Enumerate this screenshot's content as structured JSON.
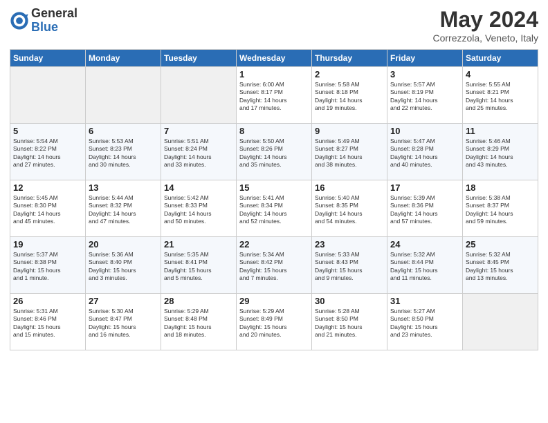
{
  "header": {
    "logo_general": "General",
    "logo_blue": "Blue",
    "month_title": "May 2024",
    "location": "Correzzola, Veneto, Italy"
  },
  "weekdays": [
    "Sunday",
    "Monday",
    "Tuesday",
    "Wednesday",
    "Thursday",
    "Friday",
    "Saturday"
  ],
  "weeks": [
    [
      {
        "day": "",
        "info": ""
      },
      {
        "day": "",
        "info": ""
      },
      {
        "day": "",
        "info": ""
      },
      {
        "day": "1",
        "info": "Sunrise: 6:00 AM\nSunset: 8:17 PM\nDaylight: 14 hours\nand 17 minutes."
      },
      {
        "day": "2",
        "info": "Sunrise: 5:58 AM\nSunset: 8:18 PM\nDaylight: 14 hours\nand 19 minutes."
      },
      {
        "day": "3",
        "info": "Sunrise: 5:57 AM\nSunset: 8:19 PM\nDaylight: 14 hours\nand 22 minutes."
      },
      {
        "day": "4",
        "info": "Sunrise: 5:55 AM\nSunset: 8:21 PM\nDaylight: 14 hours\nand 25 minutes."
      }
    ],
    [
      {
        "day": "5",
        "info": "Sunrise: 5:54 AM\nSunset: 8:22 PM\nDaylight: 14 hours\nand 27 minutes."
      },
      {
        "day": "6",
        "info": "Sunrise: 5:53 AM\nSunset: 8:23 PM\nDaylight: 14 hours\nand 30 minutes."
      },
      {
        "day": "7",
        "info": "Sunrise: 5:51 AM\nSunset: 8:24 PM\nDaylight: 14 hours\nand 33 minutes."
      },
      {
        "day": "8",
        "info": "Sunrise: 5:50 AM\nSunset: 8:26 PM\nDaylight: 14 hours\nand 35 minutes."
      },
      {
        "day": "9",
        "info": "Sunrise: 5:49 AM\nSunset: 8:27 PM\nDaylight: 14 hours\nand 38 minutes."
      },
      {
        "day": "10",
        "info": "Sunrise: 5:47 AM\nSunset: 8:28 PM\nDaylight: 14 hours\nand 40 minutes."
      },
      {
        "day": "11",
        "info": "Sunrise: 5:46 AM\nSunset: 8:29 PM\nDaylight: 14 hours\nand 43 minutes."
      }
    ],
    [
      {
        "day": "12",
        "info": "Sunrise: 5:45 AM\nSunset: 8:30 PM\nDaylight: 14 hours\nand 45 minutes."
      },
      {
        "day": "13",
        "info": "Sunrise: 5:44 AM\nSunset: 8:32 PM\nDaylight: 14 hours\nand 47 minutes."
      },
      {
        "day": "14",
        "info": "Sunrise: 5:42 AM\nSunset: 8:33 PM\nDaylight: 14 hours\nand 50 minutes."
      },
      {
        "day": "15",
        "info": "Sunrise: 5:41 AM\nSunset: 8:34 PM\nDaylight: 14 hours\nand 52 minutes."
      },
      {
        "day": "16",
        "info": "Sunrise: 5:40 AM\nSunset: 8:35 PM\nDaylight: 14 hours\nand 54 minutes."
      },
      {
        "day": "17",
        "info": "Sunrise: 5:39 AM\nSunset: 8:36 PM\nDaylight: 14 hours\nand 57 minutes."
      },
      {
        "day": "18",
        "info": "Sunrise: 5:38 AM\nSunset: 8:37 PM\nDaylight: 14 hours\nand 59 minutes."
      }
    ],
    [
      {
        "day": "19",
        "info": "Sunrise: 5:37 AM\nSunset: 8:38 PM\nDaylight: 15 hours\nand 1 minute."
      },
      {
        "day": "20",
        "info": "Sunrise: 5:36 AM\nSunset: 8:40 PM\nDaylight: 15 hours\nand 3 minutes."
      },
      {
        "day": "21",
        "info": "Sunrise: 5:35 AM\nSunset: 8:41 PM\nDaylight: 15 hours\nand 5 minutes."
      },
      {
        "day": "22",
        "info": "Sunrise: 5:34 AM\nSunset: 8:42 PM\nDaylight: 15 hours\nand 7 minutes."
      },
      {
        "day": "23",
        "info": "Sunrise: 5:33 AM\nSunset: 8:43 PM\nDaylight: 15 hours\nand 9 minutes."
      },
      {
        "day": "24",
        "info": "Sunrise: 5:32 AM\nSunset: 8:44 PM\nDaylight: 15 hours\nand 11 minutes."
      },
      {
        "day": "25",
        "info": "Sunrise: 5:32 AM\nSunset: 8:45 PM\nDaylight: 15 hours\nand 13 minutes."
      }
    ],
    [
      {
        "day": "26",
        "info": "Sunrise: 5:31 AM\nSunset: 8:46 PM\nDaylight: 15 hours\nand 15 minutes."
      },
      {
        "day": "27",
        "info": "Sunrise: 5:30 AM\nSunset: 8:47 PM\nDaylight: 15 hours\nand 16 minutes."
      },
      {
        "day": "28",
        "info": "Sunrise: 5:29 AM\nSunset: 8:48 PM\nDaylight: 15 hours\nand 18 minutes."
      },
      {
        "day": "29",
        "info": "Sunrise: 5:29 AM\nSunset: 8:49 PM\nDaylight: 15 hours\nand 20 minutes."
      },
      {
        "day": "30",
        "info": "Sunrise: 5:28 AM\nSunset: 8:50 PM\nDaylight: 15 hours\nand 21 minutes."
      },
      {
        "day": "31",
        "info": "Sunrise: 5:27 AM\nSunset: 8:50 PM\nDaylight: 15 hours\nand 23 minutes."
      },
      {
        "day": "",
        "info": ""
      }
    ]
  ]
}
